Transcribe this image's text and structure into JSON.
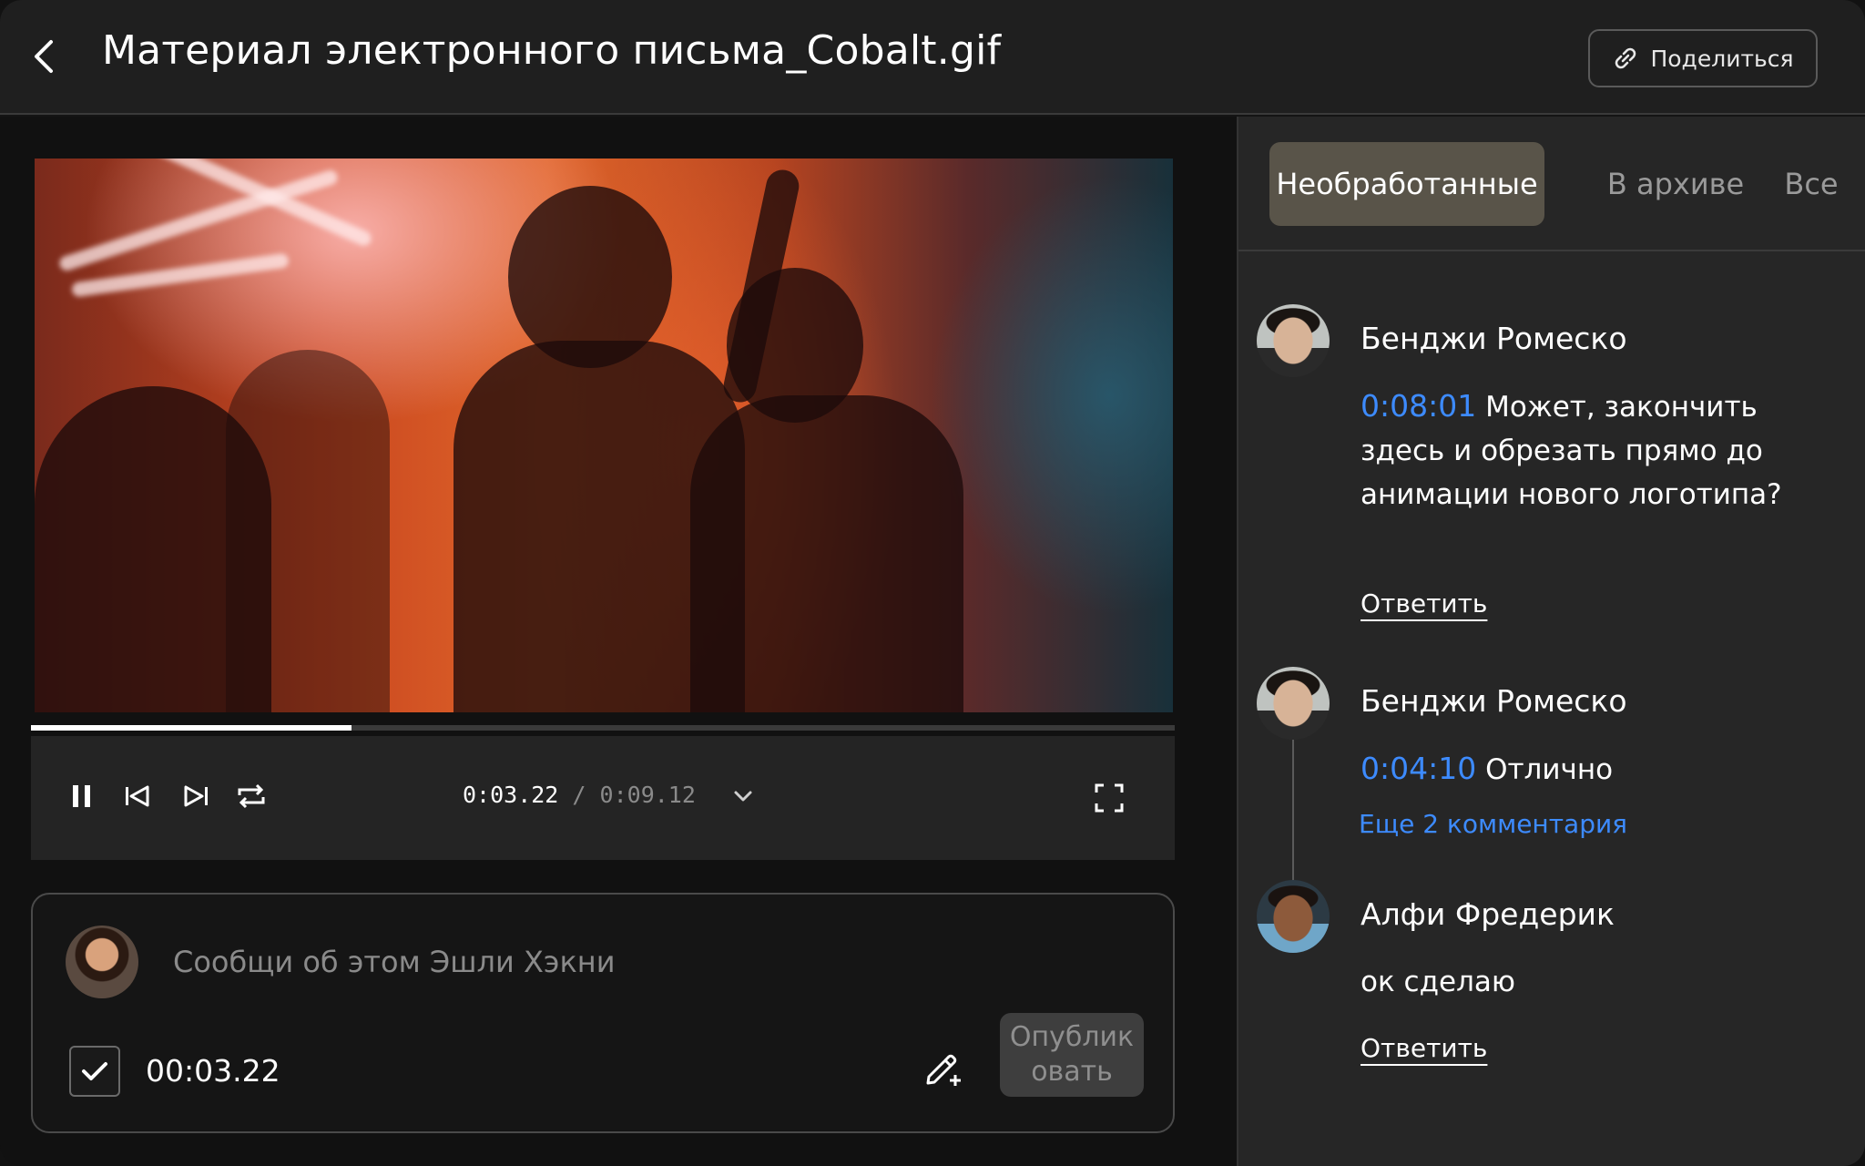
{
  "header": {
    "title": "Материал электронного письма_Cobalt.gif",
    "share_label": "Поделиться"
  },
  "player": {
    "current_time": "0:03.22",
    "separator": "/",
    "total_time": "0:09.12",
    "progress": 0.28
  },
  "composer": {
    "placeholder": "Сообщи об этом Эшли Хэкни",
    "timestamp": "00:03.22",
    "publish_label": "Опубликовать",
    "timestamp_checked": true
  },
  "sidebar": {
    "tabs": [
      {
        "label": "Необработанные",
        "active": true
      },
      {
        "label": "В архиве",
        "active": false
      },
      {
        "label": "Все",
        "active": false
      }
    ],
    "comments": [
      {
        "author": "Бенджи Ромеско",
        "timestamp": "0:08:01",
        "text": "Может, закончить здесь и обрезать прямо до анимации нового логотипа?",
        "reply_label": "Ответить"
      },
      {
        "author": "Бенджи Ромеско",
        "timestamp": "0:04:10",
        "text": "Отлично",
        "more_label": "Еще 2 комментария"
      },
      {
        "author": "Алфи Фредерик",
        "text": "ок сделаю",
        "reply_label": "Ответить"
      }
    ]
  },
  "colors": {
    "accent": "#3d8bff",
    "active_tab": "#595449",
    "sidebar_bg": "#262626"
  }
}
